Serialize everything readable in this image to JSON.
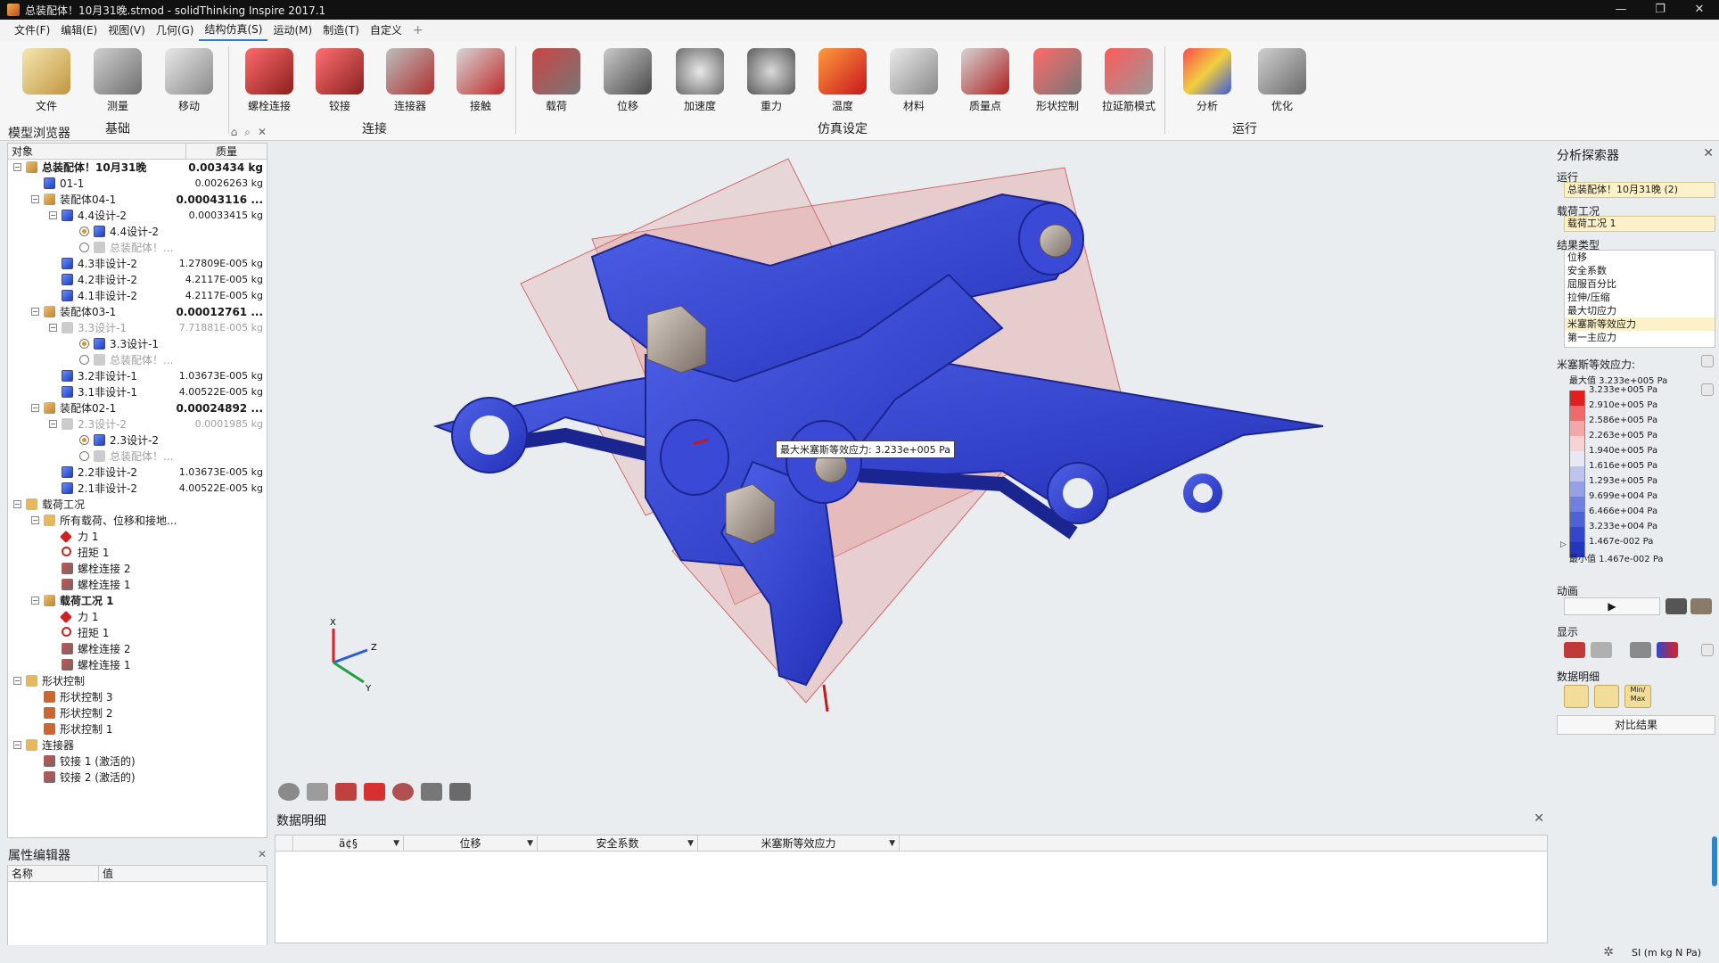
{
  "window": {
    "title": "总装配体！10月31晚.stmod - solidThinking Inspire 2017.1",
    "buttons": [
      "—",
      "❐",
      "✕"
    ]
  },
  "menu": [
    {
      "label": "文件(F)",
      "active": false
    },
    {
      "label": "编辑(E)",
      "active": false
    },
    {
      "label": "视图(V)",
      "active": false
    },
    {
      "label": "几何(G)",
      "active": false
    },
    {
      "label": "结构仿真(S)",
      "active": true
    },
    {
      "label": "运动(M)",
      "active": false
    },
    {
      "label": "制造(T)",
      "active": false
    },
    {
      "label": "自定义",
      "active": false
    }
  ],
  "ribbon": {
    "groups": [
      {
        "label": "基础",
        "buttons": [
          "文件",
          "测量",
          "移动"
        ]
      },
      {
        "label": "连接",
        "buttons": [
          "螺栓连接",
          "铰接",
          "连接器",
          "接触"
        ]
      },
      {
        "label": "仿真设定",
        "buttons": [
          "载荷",
          "位移",
          "加速度",
          "重力",
          "温度",
          "材料",
          "质量点",
          "形状控制",
          "拉延筋模式"
        ]
      },
      {
        "label": "运行",
        "buttons": [
          "分析",
          "优化"
        ]
      }
    ],
    "run_dropdown": "▼"
  },
  "model_browser": {
    "title": "模型浏览器",
    "col_object": "对象",
    "col_mass": "质量",
    "rows": [
      {
        "level": 0,
        "exp": "⊟",
        "icon": "asm",
        "label": "总装配体！10月31晚",
        "mass": "0.003434 kg",
        "bold": true,
        "massBold": true
      },
      {
        "level": 1,
        "exp": "",
        "icon": "part",
        "label": "01-1",
        "mass": "0.0026263 kg"
      },
      {
        "level": 1,
        "exp": "⊟",
        "icon": "asm",
        "label": "装配体04-1",
        "mass": "0.00043116 ...",
        "massBold": true
      },
      {
        "level": 2,
        "exp": "⊟",
        "icon": "part",
        "label": "4.4设计-2",
        "mass": "0.00033415 kg"
      },
      {
        "level": 3,
        "exp": "",
        "icon": "radio-on",
        "label": "4.4设计-2",
        "mass": ""
      },
      {
        "level": 3,
        "exp": "",
        "icon": "radio",
        "label": "总装配体！...",
        "mass": "",
        "gray": true
      },
      {
        "level": 2,
        "exp": "",
        "icon": "part",
        "label": "4.3非设计-2",
        "mass": "1.27809E-005 kg"
      },
      {
        "level": 2,
        "exp": "",
        "icon": "part",
        "label": "4.2非设计-2",
        "mass": "4.2117E-005 kg"
      },
      {
        "level": 2,
        "exp": "",
        "icon": "part",
        "label": "4.1非设计-2",
        "mass": "4.2117E-005 kg"
      },
      {
        "level": 1,
        "exp": "⊟",
        "icon": "asm",
        "label": "装配体03-1",
        "mass": "0.00012761 ...",
        "massBold": true
      },
      {
        "level": 2,
        "exp": "⊟",
        "icon": "part-ghost",
        "label": "3.3设计-1",
        "mass": "7.71881E-005 kg",
        "gray": true,
        "massGray": true
      },
      {
        "level": 3,
        "exp": "",
        "icon": "radio-on",
        "label": "3.3设计-1",
        "mass": ""
      },
      {
        "level": 3,
        "exp": "",
        "icon": "radio",
        "label": "总装配体！...",
        "mass": "",
        "gray": true
      },
      {
        "level": 2,
        "exp": "",
        "icon": "part",
        "label": "3.2非设计-1",
        "mass": "1.03673E-005 kg"
      },
      {
        "level": 2,
        "exp": "",
        "icon": "part",
        "label": "3.1非设计-1",
        "mass": "4.00522E-005 kg"
      },
      {
        "level": 1,
        "exp": "⊟",
        "icon": "asm",
        "label": "装配体02-1",
        "mass": "0.00024892 ...",
        "massBold": true
      },
      {
        "level": 2,
        "exp": "⊟",
        "icon": "part-ghost",
        "label": "2.3设计-2",
        "mass": "0.0001985 kg",
        "gray": true,
        "massGray": true
      },
      {
        "level": 3,
        "exp": "",
        "icon": "radio-on",
        "label": "2.3设计-2",
        "mass": ""
      },
      {
        "level": 3,
        "exp": "",
        "icon": "radio",
        "label": "总装配体！...",
        "mass": "",
        "gray": true
      },
      {
        "level": 2,
        "exp": "",
        "icon": "part",
        "label": "2.2非设计-2",
        "mass": "1.03673E-005 kg"
      },
      {
        "level": 2,
        "exp": "",
        "icon": "part",
        "label": "2.1非设计-2",
        "mass": "4.00522E-005 kg"
      },
      {
        "level": 0,
        "exp": "⊟",
        "icon": "folder",
        "label": "载荷工况",
        "mass": ""
      },
      {
        "level": 1,
        "exp": "⊟",
        "icon": "folder",
        "label": "所有载荷、位移和接地...",
        "mass": ""
      },
      {
        "level": 2,
        "exp": "",
        "icon": "force",
        "label": "力 1",
        "mass": ""
      },
      {
        "level": 2,
        "exp": "",
        "icon": "torque",
        "label": "扭矩 1",
        "mass": ""
      },
      {
        "level": 2,
        "exp": "",
        "icon": "bolt",
        "label": "螺栓连接 2",
        "mass": ""
      },
      {
        "level": 2,
        "exp": "",
        "icon": "bolt",
        "label": "螺栓连接 1",
        "mass": ""
      },
      {
        "level": 1,
        "exp": "⊟",
        "icon": "asm",
        "label": "载荷工况 1",
        "mass": "",
        "bold": true
      },
      {
        "level": 2,
        "exp": "",
        "icon": "force",
        "label": "力 1",
        "mass": ""
      },
      {
        "level": 2,
        "exp": "",
        "icon": "torque",
        "label": "扭矩 1",
        "mass": ""
      },
      {
        "level": 2,
        "exp": "",
        "icon": "bolt",
        "label": "螺栓连接 2",
        "mass": ""
      },
      {
        "level": 2,
        "exp": "",
        "icon": "bolt",
        "label": "螺栓连接 1",
        "mass": ""
      },
      {
        "level": 0,
        "exp": "⊟",
        "icon": "folder",
        "label": "形状控制",
        "mass": ""
      },
      {
        "level": 1,
        "exp": "",
        "icon": "shape",
        "label": "形状控制 3",
        "mass": ""
      },
      {
        "level": 1,
        "exp": "",
        "icon": "shape",
        "label": "形状控制 2",
        "mass": ""
      },
      {
        "level": 1,
        "exp": "",
        "icon": "shape",
        "label": "形状控制 1",
        "mass": ""
      },
      {
        "level": 0,
        "exp": "⊟",
        "icon": "folder",
        "label": "连接器",
        "mass": ""
      },
      {
        "level": 1,
        "exp": "",
        "icon": "bolt",
        "label": "铰接 1 (激活的)",
        "mass": ""
      },
      {
        "level": 1,
        "exp": "",
        "icon": "bolt",
        "label": "铰接 2 (激活的)",
        "mass": ""
      }
    ]
  },
  "property_editor": {
    "title": "属性编辑器",
    "col_name": "名称",
    "col_value": "值"
  },
  "viewport": {
    "tooltip": "最大米塞斯等效应力: 3.233e+005 Pa",
    "axis_labels": {
      "x": "X",
      "y": "Y",
      "z": "Z"
    }
  },
  "data_panel": {
    "title": "数据明细",
    "columns": [
      "ä¢§",
      "位移",
      "安全系数",
      "米塞斯等效应力"
    ]
  },
  "analysis_explorer": {
    "title": "分析探索器",
    "run_label": "运行",
    "run_value": "总装配体！10月31晚 (2)",
    "loadcase_label": "载荷工况",
    "loadcase_value": "载荷工况 1",
    "result_type_label": "结果类型",
    "result_types": [
      "位移",
      "安全系数",
      "屈服百分比",
      "拉伸/压缩",
      "最大切应力",
      "米塞斯等效应力",
      "第一主应力"
    ],
    "selected_result": "米塞斯等效应力",
    "legend_title": "米塞斯等效应力:",
    "legend_max": "最大值 3.233e+005 Pa",
    "legend_min": "最小值 1.467e-002 Pa",
    "legend_values": [
      "3.233e+005 Pa",
      "2.910e+005 Pa",
      "2.586e+005 Pa",
      "2.263e+005 Pa",
      "1.940e+005 Pa",
      "1.616e+005 Pa",
      "1.293e+005 Pa",
      "9.699e+004 Pa",
      "6.466e+004 Pa",
      "3.233e+004 Pa",
      "1.467e-002 Pa"
    ],
    "legend_colors": [
      "#e02020",
      "#ef6b6b",
      "#f4a7a7",
      "#f7d3d3",
      "#e8e8f5",
      "#bfc4ee",
      "#96a0e6",
      "#7080de",
      "#4e62d6",
      "#3447cc",
      "#2235bf"
    ],
    "animation_label": "动画",
    "display_label": "显示",
    "data_detail_label": "数据明细",
    "minmax_label": "Min/\nMax",
    "compare_button": "对比结果"
  },
  "status": {
    "units": "SI (m kg N Pa)"
  }
}
